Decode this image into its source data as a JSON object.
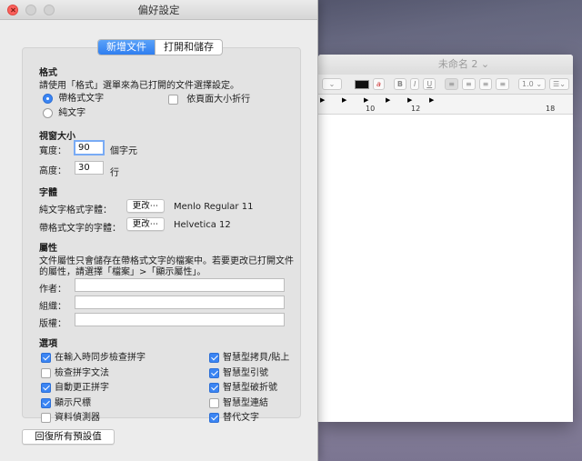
{
  "editor": {
    "title": "未命名 2 ⌄",
    "ruler_labels": [
      "10",
      "12",
      "18"
    ],
    "toolbar": {
      "bold": "B",
      "italic": "I",
      "underline": "U",
      "spacing": "1.0 ⌄",
      "list": "☰⌄",
      "text_color": "a"
    }
  },
  "prefs": {
    "window_title": "偏好設定",
    "tabs": [
      "新增文件",
      "打開和儲存"
    ],
    "format": {
      "heading": "格式",
      "desc": "請使用「格式」選單來為已打開的文件選擇設定。",
      "rich_text": "帶格式文字",
      "plain_text": "純文字",
      "wrap_to_page": "依頁面大小折行"
    },
    "window_size": {
      "heading": "視窗大小",
      "width_label": "寬度：",
      "width_value": "90",
      "width_unit": "個字元",
      "height_label": "高度：",
      "height_value": "30",
      "height_unit": "行"
    },
    "font": {
      "heading": "字體",
      "plain_label": "純文字格式字體：",
      "plain_button": "更改⋯",
      "plain_font": "Menlo Regular 11",
      "rich_label": "帶格式文字的字體：",
      "rich_button": "更改⋯",
      "rich_font": "Helvetica 12"
    },
    "properties": {
      "heading": "屬性",
      "desc_line1": "文件屬性只會儲存在帶格式文字的檔案中。若要更改已打開文件",
      "desc_line2": "的屬性，請選擇「檔案」>「顯示屬性」。",
      "author": "作者：",
      "organization": "組織：",
      "copyright": "版權："
    },
    "options": {
      "heading": "選項",
      "left": [
        {
          "label": "在輸入時同步檢查拼字",
          "checked": true
        },
        {
          "label": "檢查拼字文法",
          "checked": false
        },
        {
          "label": "自動更正拼字",
          "checked": true
        },
        {
          "label": "顯示尺標",
          "checked": true
        },
        {
          "label": "資料偵測器",
          "checked": false
        }
      ],
      "right": [
        {
          "label": "智慧型拷貝/貼上",
          "checked": true
        },
        {
          "label": "智慧型引號",
          "checked": true
        },
        {
          "label": "智慧型破折號",
          "checked": true
        },
        {
          "label": "智慧型連結",
          "checked": false
        },
        {
          "label": "替代文字",
          "checked": true
        }
      ]
    },
    "restore_button": "回復所有預設值"
  },
  "colors": {
    "accent": "#3b85f3",
    "close": "#fc605c"
  }
}
